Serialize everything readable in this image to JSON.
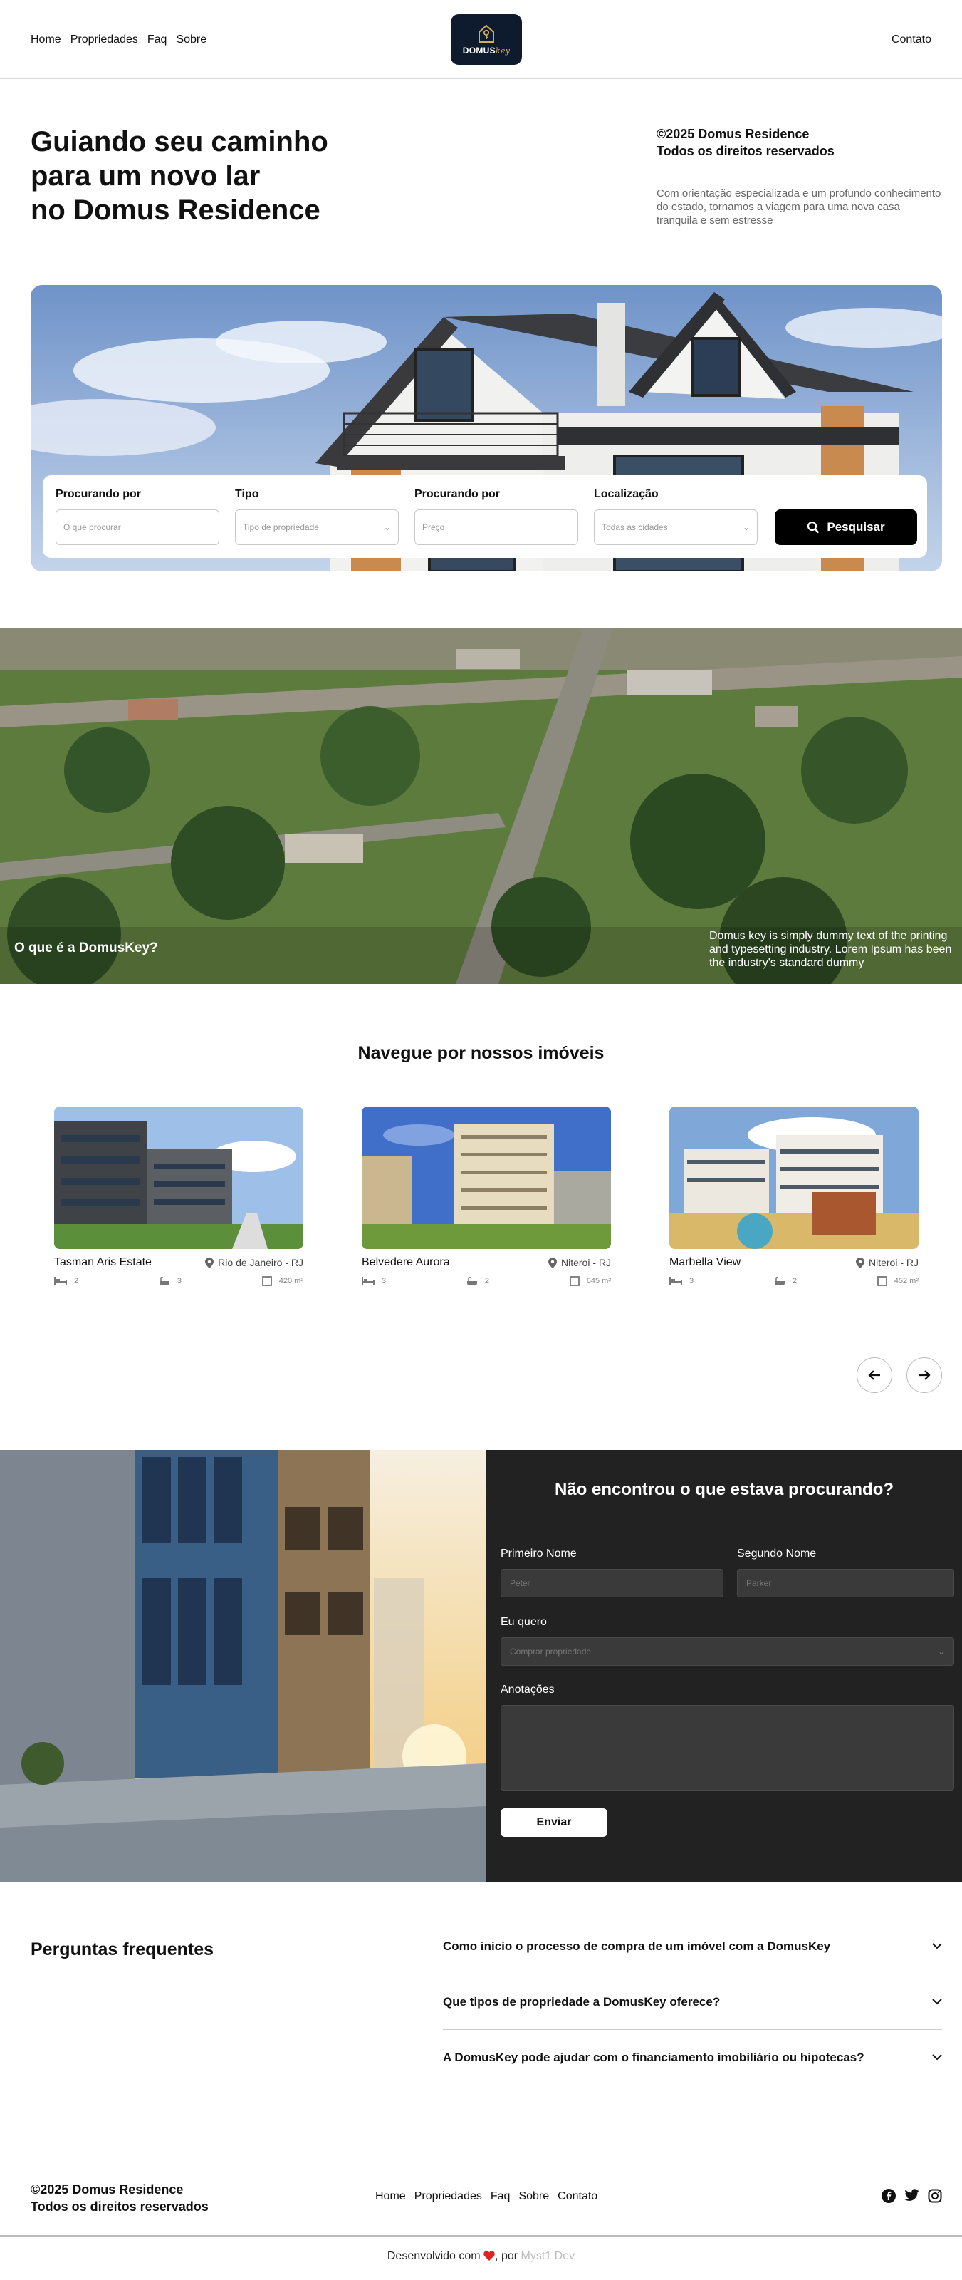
{
  "header": {
    "nav": [
      "Home",
      "Propriedades",
      "Faq",
      "Sobre"
    ],
    "logo_main": "DOMUS",
    "logo_accent": "key",
    "contact": "Contato"
  },
  "hero": {
    "title_lines": [
      "Guiando seu caminho",
      "para um novo lar",
      "no Domus Residence"
    ],
    "copyright_lines": [
      "©2025 Domus Residence",
      "Todos os direitos reservados"
    ],
    "description": "Com orientação especializada e um profundo conhecimento do estado, tornamos a viagem para uma nova casa tranquila e sem estresse"
  },
  "search": {
    "fields": [
      {
        "label": "Procurando por",
        "placeholder": "O que procurar",
        "dropdown": false
      },
      {
        "label": "Tipo",
        "placeholder": "Tipo de propriedade",
        "dropdown": true
      },
      {
        "label": "Procurando por",
        "placeholder": "Preço",
        "dropdown": false
      },
      {
        "label": "Localização",
        "placeholder": "Todas as cidades",
        "dropdown": true
      }
    ],
    "button": "Pesquisar"
  },
  "about": {
    "title": "O que é a DomusKey?",
    "text": "Domus key is simply dummy text of the printing and typesetting industry. Lorem Ipsum has been the industry's standard dummy"
  },
  "listings": {
    "title": "Navegue por nossos imóveis",
    "items": [
      {
        "name": "Tasman Aris Estate",
        "location": "Rio de Janeiro - RJ",
        "beds": "2",
        "baths": "3",
        "area": "420 m²"
      },
      {
        "name": "Belvedere Aurora",
        "location": "Niteroi - RJ",
        "beds": "3",
        "baths": "2",
        "area": "645 m²"
      },
      {
        "name": "Marbella View",
        "location": "Niteroi - RJ",
        "beds": "3",
        "baths": "2",
        "area": "452 m²"
      }
    ]
  },
  "form": {
    "title": "Não encontrou o que estava procurando?",
    "first_name_label": "Primeiro Nome",
    "first_name_placeholder": "Peter",
    "last_name_label": "Segundo Nome",
    "last_name_placeholder": "Parker",
    "want_label": "Eu quero",
    "want_value": "Comprar propriedade",
    "notes_label": "Anotações",
    "submit": "Enviar"
  },
  "faq": {
    "title": "Perguntas frequentes",
    "items": [
      "Como inicio o processo de compra de um imóvel com a DomusKey",
      "Que tipos de propriedade a DomusKey oferece?",
      "A DomusKey pode ajudar com o financiamento imobiliário ou hipotecas?"
    ]
  },
  "footer": {
    "copyright_lines": [
      "©2025 Domus Residence",
      "Todos os direitos reservados"
    ],
    "nav": [
      "Home",
      "Propriedades",
      "Faq",
      "Sobre",
      "Contato"
    ],
    "credit_prefix": "Desenvolvido com",
    "credit_by": ", por",
    "credit_author": "Myst1 Dev"
  },
  "colors": {
    "dark": "#222222",
    "logo_bg": "#0e1b2e",
    "accent": "#d6a95c",
    "heart": "#e02424"
  }
}
